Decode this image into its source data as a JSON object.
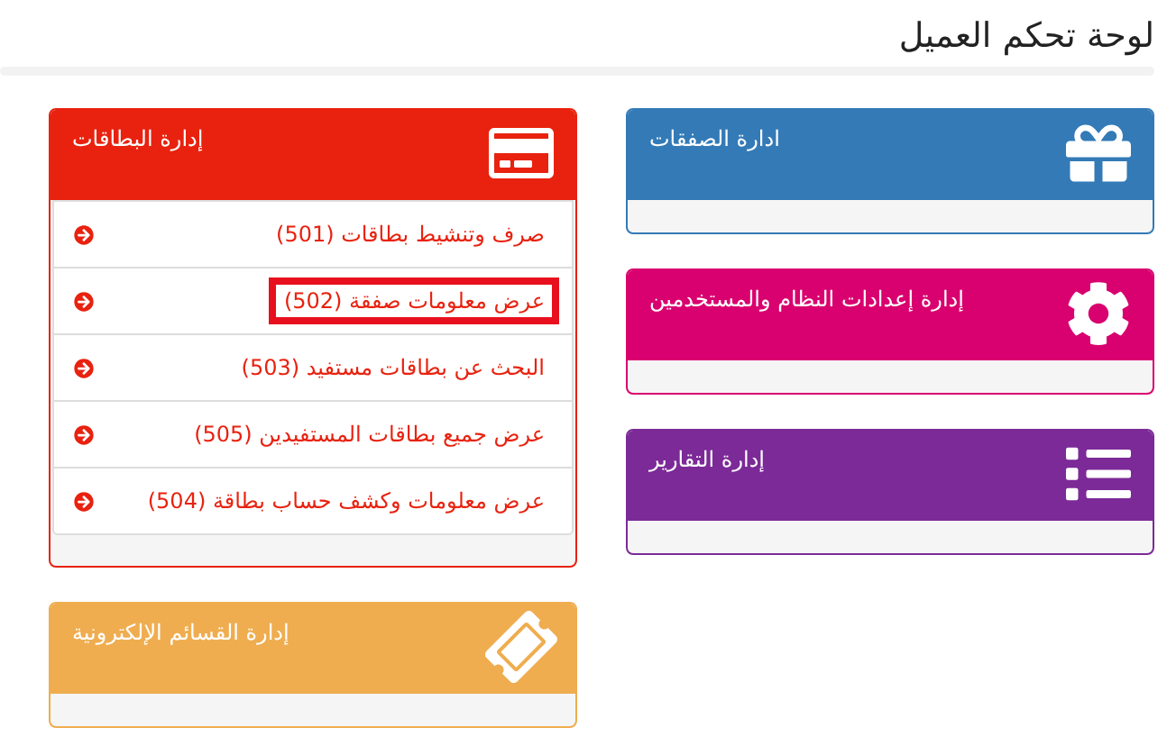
{
  "title": "لوحة تحكم العميل",
  "columns": [
    {
      "panels": [
        {
          "title": "ادارة الصفقات",
          "color": "#337ab7",
          "kind": "gift"
        },
        {
          "title": "إدارة إعدادات النظام والمستخدمين",
          "color": "#d9006f",
          "kind": "gear"
        },
        {
          "title": "إدارة التقارير",
          "color": "#7b2a97",
          "kind": "list"
        }
      ]
    },
    {
      "panels": [
        {
          "title": "إدارة البطاقات",
          "color": "#e8220f",
          "kind": "card",
          "links": [
            {
              "label": "صرف وتنشيط بطاقات (501)",
              "highlighted": false
            },
            {
              "label": "عرض معلومات صفقة (502)",
              "highlighted": true
            },
            {
              "label": "البحث عن بطاقات مستفيد (503)",
              "highlighted": false
            },
            {
              "label": "عرض جميع بطاقات المستفيدين (505)",
              "highlighted": false
            },
            {
              "label": "عرض معلومات وكشف حساب بطاقة (504)",
              "highlighted": false
            }
          ]
        },
        {
          "title": "إدارة القسائم الإلكترونية",
          "color": "#efad4f",
          "kind": "ticket"
        }
      ]
    }
  ]
}
